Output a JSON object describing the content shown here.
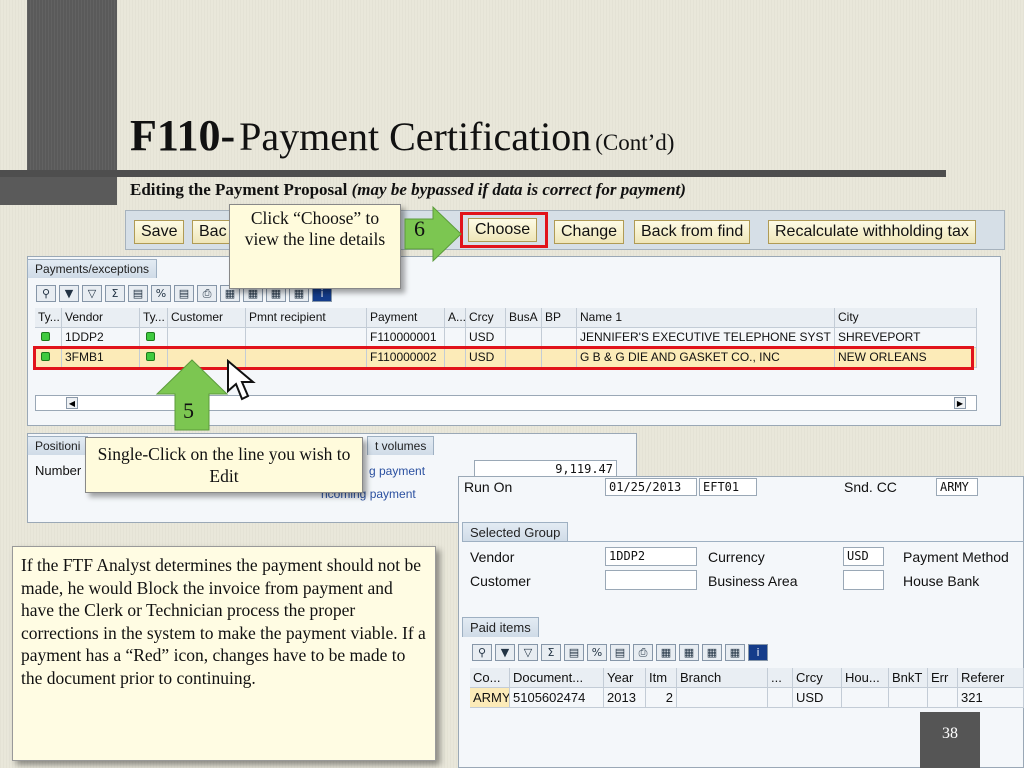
{
  "slide": {
    "title_bold": "F110-",
    "title_main": "Payment Certification",
    "title_suffix": "(Cont’d)",
    "subtitle_bold": "Editing the Payment Proposal",
    "subtitle_italic": "(may be bypassed if data is correct for payment)",
    "page_number": "38"
  },
  "toolbar": {
    "save": "Save",
    "back_partial": "Bac",
    "choose": "Choose",
    "change": "Change",
    "back_from_find": "Back from find",
    "recalc": "Recalculate withholding tax"
  },
  "callouts": {
    "choose_text": "Click “Choose” to view the line details",
    "choose_step": "6",
    "select_text": "Single-Click on the line you wish to Edit",
    "select_step": "5"
  },
  "payments": {
    "header": "Payments/exceptions",
    "columns": [
      "Ty...",
      "Vendor",
      "Ty...",
      "Customer",
      "Pmnt recipient",
      "Payment",
      "A...",
      "Crcy",
      "BusA",
      "BP",
      "Name 1",
      "City"
    ],
    "rows": [
      {
        "vendor": "1DDP2",
        "customer": "",
        "recipient": "",
        "payment": "F110000001",
        "a": "",
        "crcy": "USD",
        "busa": "",
        "bp": "",
        "name": "JENNIFER'S EXECUTIVE TELEPHONE SYST",
        "city": "SHREVEPORT"
      },
      {
        "vendor": "3FMB1",
        "customer": "",
        "recipient": "",
        "payment": "F110000002",
        "a": "",
        "crcy": "USD",
        "busa": "",
        "bp": "",
        "name": "G B & G DIE AND GASKET CO., INC",
        "city": "NEW ORLEANS"
      }
    ]
  },
  "positioning": {
    "header_partial": "Positioni",
    "number_partial": "Number",
    "volumes_header_partial": "t volumes",
    "outgoing_partial": "g payment",
    "incoming_partial": "ncoming payment",
    "outgoing_value": "9,119.47"
  },
  "detail": {
    "run_on_label": "Run On",
    "run_on_value": "01/25/2013",
    "run_id": "EFT01",
    "snd_cc_label": "Snd. CC",
    "snd_cc_value": "ARMY",
    "selected_group_header": "Selected Group",
    "vendor_label": "Vendor",
    "vendor_value": "1DDP2",
    "currency_label": "Currency",
    "currency_value": "USD",
    "payment_method_label": "Payment Method",
    "customer_label": "Customer",
    "business_area_label": "Business Area",
    "house_bank_label": "House Bank",
    "paid_items_header": "Paid items",
    "paid_columns": [
      "Co...",
      "Document...",
      "Year",
      "Itm",
      "Branch",
      "...",
      "Crcy",
      "Hou...",
      "BnkT",
      "Err",
      "Referer"
    ],
    "paid_rows": [
      {
        "co": "ARMY",
        "doc": "5105602474",
        "year": "2013",
        "itm": "2",
        "branch": "",
        "dots": "",
        "crcy": "USD",
        "hou": "",
        "bnkt": "",
        "err": "",
        "ref": "321"
      }
    ]
  },
  "note": "If the FTF Analyst determines the payment should not be made, he would Block the invoice from payment  and have the Clerk or Technician process the proper corrections in the system to make the payment viable.  If a payment has a “Red” icon, changes have to be made to the document prior to continuing.",
  "colors": {
    "highlight_red": "#e1131b",
    "arrow_green": "#7cc651",
    "selected_row": "#fcebb8"
  }
}
